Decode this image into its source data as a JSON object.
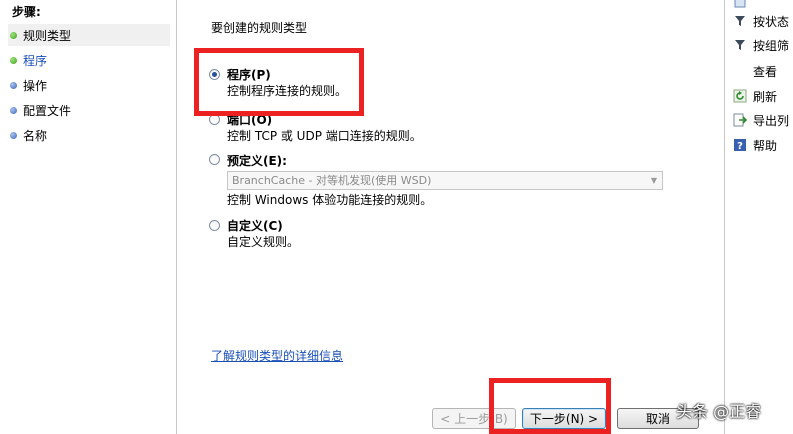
{
  "steps": {
    "title": "步骤:",
    "items": [
      {
        "label": "规则类型",
        "state": "current"
      },
      {
        "label": "程序",
        "state": "link"
      },
      {
        "label": "操作",
        "state": "normal"
      },
      {
        "label": "配置文件",
        "state": "normal"
      },
      {
        "label": "名称",
        "state": "normal"
      }
    ]
  },
  "main": {
    "heading": "要创建的规则类型",
    "options": [
      {
        "label": "程序(P)",
        "desc": "控制程序连接的规则。",
        "checked": true
      },
      {
        "label": "端口(O)",
        "desc": "控制 TCP 或 UDP 端口连接的规则。",
        "checked": false
      },
      {
        "label": "预定义(E):",
        "desc": "控制 Windows 体验功能连接的规则。",
        "checked": false
      },
      {
        "label": "自定义(C)",
        "desc": "自定义规则。",
        "checked": false
      }
    ],
    "predefined_select": "BranchCache - 对等机发现(使用 WSD)",
    "help_link": "了解规则类型的详细信息"
  },
  "buttons": {
    "back": "< 上一步(B)",
    "next": "下一步(N) >",
    "cancel": "取消"
  },
  "actions": {
    "items": [
      {
        "label": "按状态",
        "icon": "filter-icon"
      },
      {
        "label": "按组筛",
        "icon": "filter-icon"
      },
      {
        "label": "查看",
        "icon": "none"
      },
      {
        "label": "刷新",
        "icon": "refresh-icon"
      },
      {
        "label": "导出列",
        "icon": "export-icon"
      },
      {
        "label": "帮助",
        "icon": "help-icon"
      }
    ]
  },
  "watermark": "头条 @正睿",
  "colors": {
    "highlight": "#ec2222",
    "link": "#1a4fb8"
  }
}
